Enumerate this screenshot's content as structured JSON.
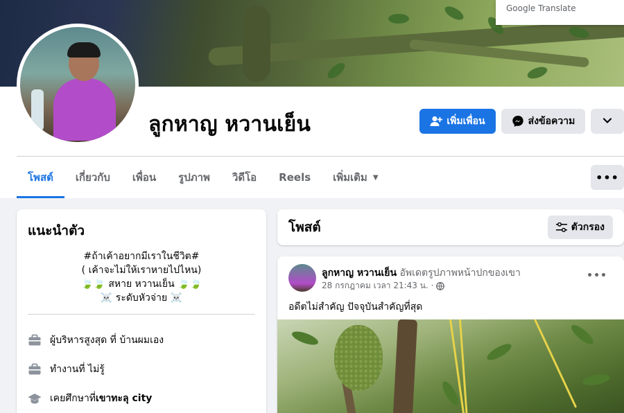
{
  "translate_badge": {
    "label": "Google Translate"
  },
  "profile": {
    "name": "ลูกหาญ หวานเย็น",
    "add_friend_label": "เพิ่มเพื่อน",
    "message_label": "ส่งข้อความ"
  },
  "tabs": [
    {
      "label": "โพสต์",
      "active": true
    },
    {
      "label": "เกี่ยวกับ",
      "active": false
    },
    {
      "label": "เพื่อน",
      "active": false
    },
    {
      "label": "รูปภาพ",
      "active": false
    },
    {
      "label": "วิดีโอ",
      "active": false
    },
    {
      "label": "Reels",
      "active": false
    },
    {
      "label": "เพิ่มเติม",
      "active": false
    }
  ],
  "intro": {
    "title": "แนะนำตัว",
    "bio": [
      "#ถ้าเค้าอยากมีเราในชีวิต#",
      "( เค้าจะไม่ให้เราหายไปไหน)",
      "🍃🍃 สหาย หวานเย็น 🍃🍃",
      "☠️ ระดับหัวจ่าย ☠️"
    ],
    "work1": "ผู้บริหารสูงสุด ที่ บ้านผมเอง",
    "work2": "ทำงานที่ ไม่รู้",
    "edu_prefix": "เคยศึกษาที่ ",
    "edu_place": "เขาทะลุ city"
  },
  "posts_header": {
    "title": "โพสต์",
    "filter_label": "ตัวกรอง"
  },
  "post": {
    "author": "ลูกหาญ หวานเย็น",
    "action": " อัพเดตรูปภาพหน้าปกของเขา",
    "time": "28 กรกฎาคม เวลา 21:43 น. ·",
    "text": "อดีตไม่สำคัญ ปัจจุบันสำคัญที่สุด"
  },
  "colors": {
    "accent": "#1b74e4",
    "button_gray": "#e4e6eb",
    "page_bg": "#f0f2f5"
  }
}
